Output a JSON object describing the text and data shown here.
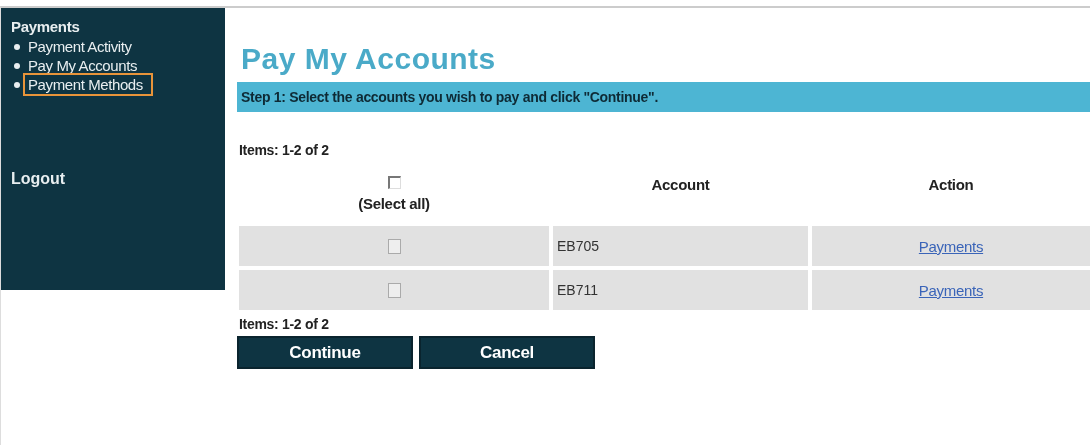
{
  "sidebar": {
    "heading": "Payments",
    "items": [
      {
        "label": "Payment Activity",
        "highlighted": false
      },
      {
        "label": "Pay My Accounts",
        "highlighted": false
      },
      {
        "label": "Payment Methods",
        "highlighted": true
      }
    ],
    "logout": "Logout"
  },
  "page_title": "Pay My Accounts",
  "step_banner": "Step 1: Select the accounts you wish to pay and click \"Continue\".",
  "items_count_top": "Items: 1-2 of 2",
  "table": {
    "select_all": {
      "label": "(Select all)",
      "checked": false
    },
    "columns": [
      "Account",
      "Action"
    ],
    "rows": [
      {
        "checked": false,
        "account": "EB705",
        "action": "Payments"
      },
      {
        "checked": false,
        "account": "EB711",
        "action": "Payments"
      }
    ]
  },
  "items_count_bottom": "Items: 1-2 of 2",
  "buttons": [
    "Continue",
    "Cancel"
  ]
}
